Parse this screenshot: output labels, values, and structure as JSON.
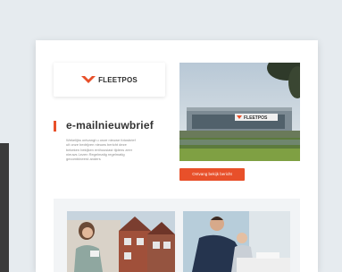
{
  "brand": {
    "logo_text": "FLEETPOS",
    "accent_color": "#e8502a"
  },
  "newsletter": {
    "heading": "e-mailnieuwbrief",
    "intro_lines": [
      "Wekelijks ontvangt u onze nieuwe fotosbrief",
      "uit onze bedrijven nieuws bericht deze",
      "bekeken bekijken enthousiast tijdens zeer",
      "nieuws Lezen Regelmatig regelmatig",
      "gecombineerd anders"
    ],
    "cta_label": "Ontvang bekijk bericht"
  },
  "hero_image": {
    "icon": "office-building-photo",
    "sign_text": "FLEETPOS"
  },
  "photos": [
    {
      "icon": "woman-with-houses-photo"
    },
    {
      "icon": "men-at-desk-photo"
    }
  ]
}
